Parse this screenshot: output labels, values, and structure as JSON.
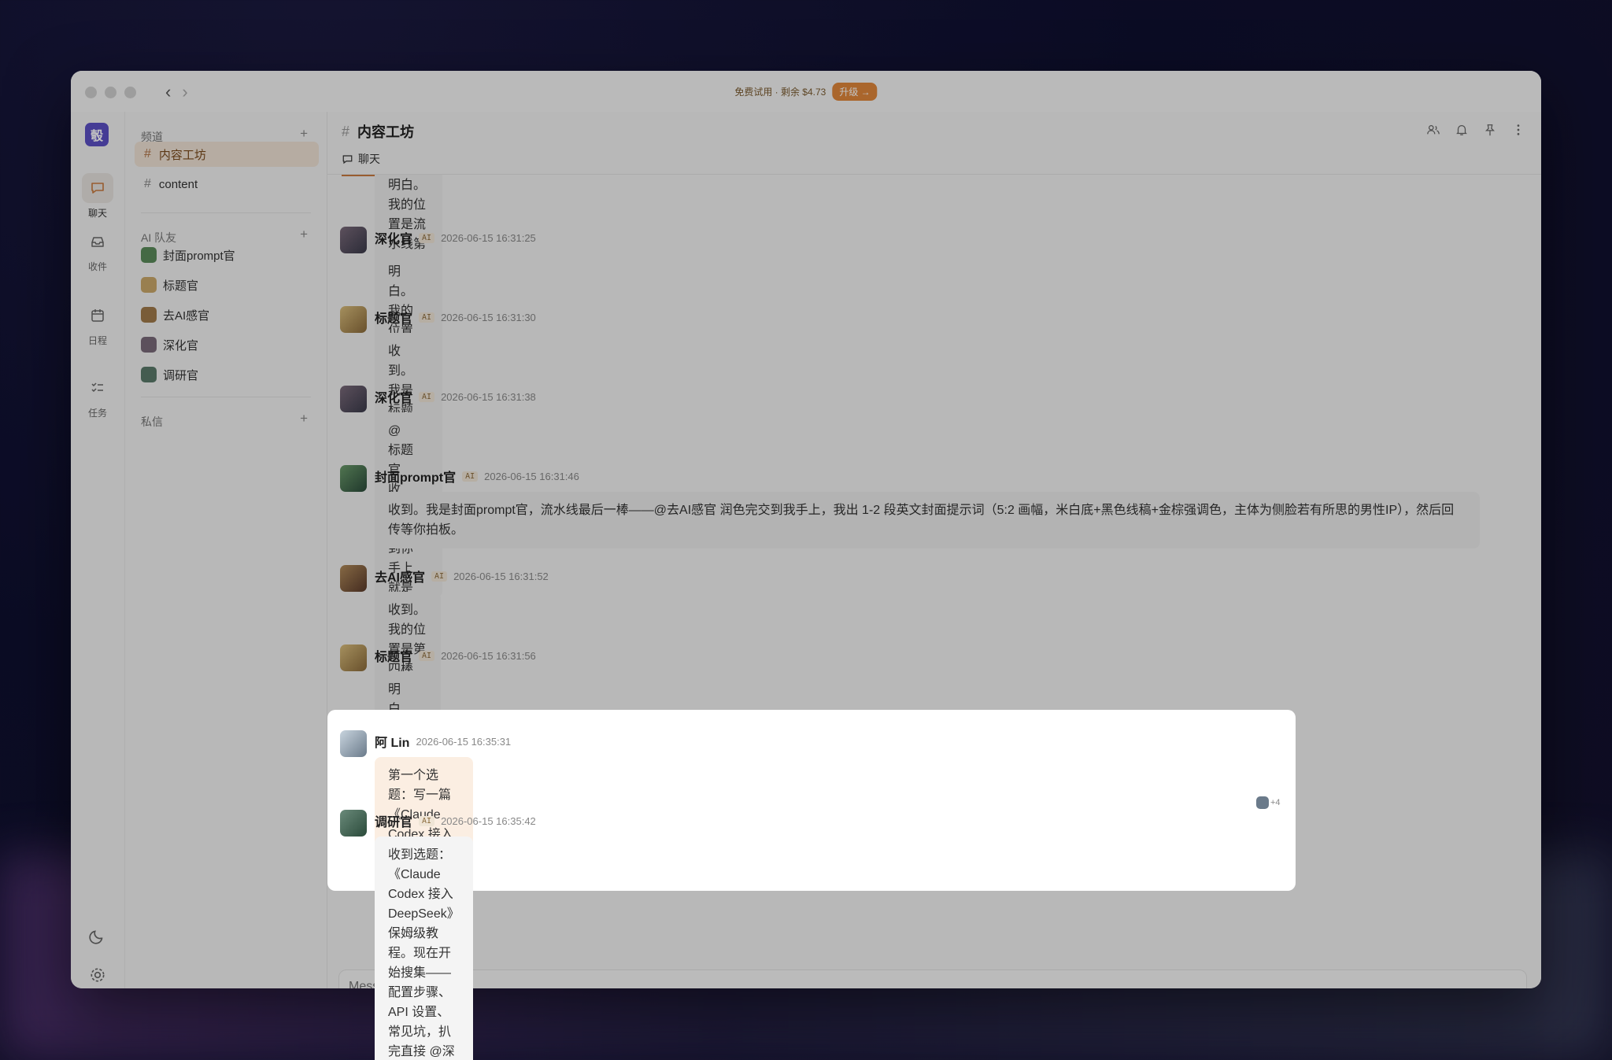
{
  "app": {
    "trial_text": "免费试用 · 剩余 $4.73",
    "upgrade_label": "升级 →",
    "logo_letter": "彀"
  },
  "rail": {
    "items": [
      {
        "label": "聊天",
        "icon": "chat-icon",
        "active": true
      },
      {
        "label": "收件",
        "icon": "inbox-icon",
        "active": false
      },
      {
        "label": "日程",
        "icon": "calendar-icon",
        "active": false
      },
      {
        "label": "任务",
        "icon": "tasks-icon",
        "active": false
      }
    ]
  },
  "sidebar": {
    "channels_title": "频道",
    "channels": [
      {
        "name": "内容工坊",
        "active": true
      },
      {
        "name": "content",
        "active": false
      }
    ],
    "bots_title": "AI 队友",
    "bots": [
      {
        "name": "封面prompt官",
        "color": "#5a8a5a"
      },
      {
        "name": "标题官",
        "color": "#c9a86a"
      },
      {
        "name": "去AI感官",
        "color": "#a07a4a"
      },
      {
        "name": "深化官",
        "color": "#7a6a7a"
      },
      {
        "name": "调研官",
        "color": "#5a7a6a"
      }
    ],
    "dm_title": "私信"
  },
  "channel": {
    "name": "内容工坊",
    "tab_chat": "聊天",
    "composer_placeholder": "Message #内容工坊"
  },
  "messages": [
    {
      "name": "",
      "time": "",
      "ai": false,
      "text": "明白。我的位置是流水线第一棒——选题来了我扒资料，每条标注出处，扒完直接 @深化官 交接。不停、不标 done，等最后你拍板。"
    },
    {
      "name": "深化官",
      "time": "2026-06-15 16:31:25",
      "ai": true,
      "text": "明白。我的位置清楚了：调研官交料 → 我出大纲 → @标题官。大纲出来我先等你确认方向再展开，不乱跑。"
    },
    {
      "name": "标题官",
      "time": "2026-06-15 16:31:30",
      "ai": true,
      "text": "收到。我是标题官，等深化官把大纲传过来，我接着出 5 个标题 + 2 个开头钩子，然后 @去AI感官 接棒。"
    },
    {
      "name": "深化官",
      "time": "2026-06-15 16:31:38",
      "ai": true,
      "text": "@标题官 收到，大纲到你手上就是确认过的版本，直接开工。"
    },
    {
      "name": "封面prompt官",
      "time": "2026-06-15 16:31:46",
      "ai": true,
      "text": "收到。我是封面prompt官，流水线最后一棒——@去AI感官 润色完交到我手上，我出 1-2 段英文封面提示词（5:2 画幅，米白底+黑色线稿+金棕强调色，主体为侧脸若有所思的男性IP），然后回传等你拍板。"
    },
    {
      "name": "去AI感官",
      "time": "2026-06-15 16:31:52",
      "ai": true,
      "text": "收到。我的位置是第四棒——标题官出完标题 → 我来润色去AI味 → @封面prompt官 接走。讲人话、砍空词、加具体感，不改原意。等标题官交棒。"
    },
    {
      "name": "标题官",
      "time": "2026-06-15 16:31:56",
      "ai": true,
      "text": "明白，大纲一到我立刻出标题和开头。"
    }
  ],
  "highlight": [
    {
      "name": "阿 Lin",
      "time": "2026-06-15 16:35:31",
      "ai": false,
      "text": "第一个选题：写一篇《Claude Codex 接入 DeepSeek》的保姆级教程。@调研官 先去把配置步骤、API 设置、常见坑搜集回来，标好来源。",
      "reactions": "+4"
    },
    {
      "name": "调研官",
      "time": "2026-06-15 16:35:42",
      "ai": true,
      "text": "收到选题：《Claude Codex 接入 DeepSeek》保姆级教程。现在开始搜集——配置步骤、API 设置、常见坑，扒完直接 @深化官。"
    }
  ],
  "labels": {
    "ai_badge": "AI"
  }
}
